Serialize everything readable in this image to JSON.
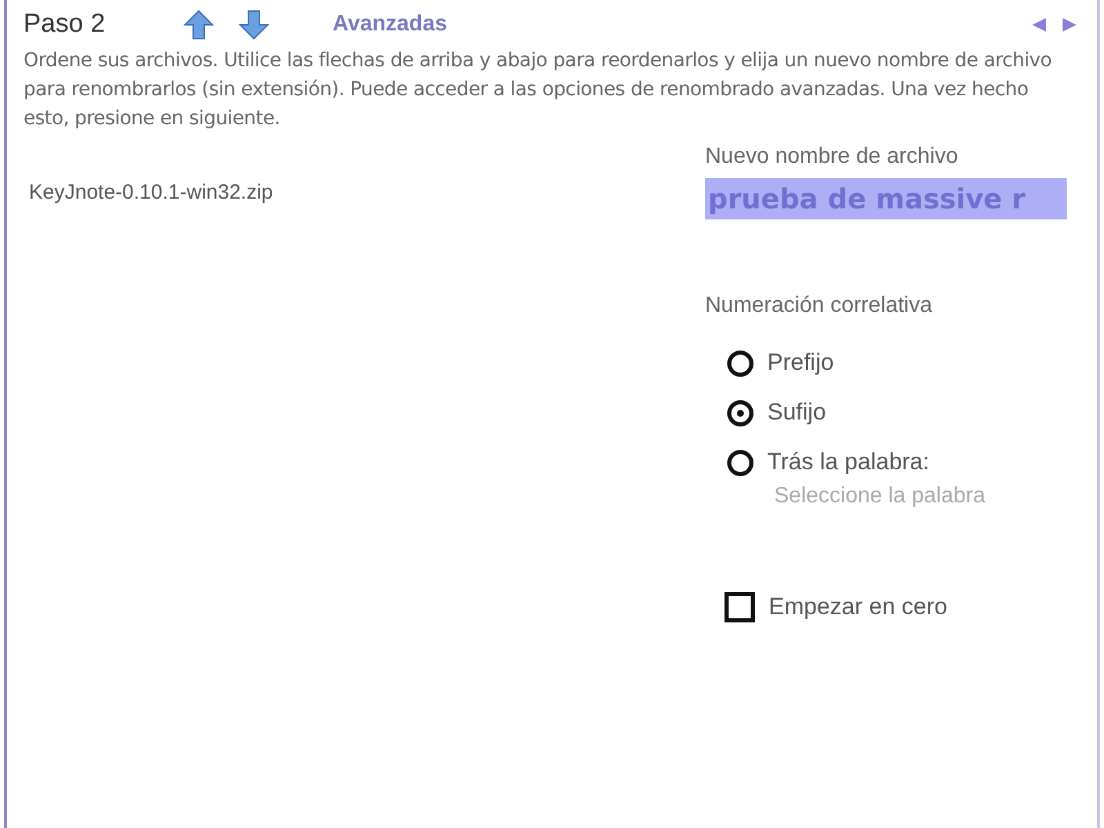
{
  "header": {
    "title": "Paso 2",
    "advanced_link": "Avanzadas"
  },
  "instructions": "Ordene sus archivos. Utilice las flechas de arriba y abajo para reordenarlos y elija un nuevo nombre de archivo para renombrarlos (sin extensión). Puede acceder a las opciones de renombrado avanzadas. Una vez hecho esto, presione en siguiente.",
  "files": [
    {
      "name": "KeyJnote-0.10.1-win32.zip",
      "selected": false
    }
  ],
  "new_name": {
    "label": "Nuevo nombre de archivo",
    "value": "prueba de massive r"
  },
  "numbering": {
    "label": "Numeración correlativa",
    "options": [
      {
        "label": "Prefijo",
        "selected": false
      },
      {
        "label": "Sufijo",
        "selected": true
      },
      {
        "label": "Trás la palabra:",
        "selected": false
      }
    ],
    "word_hint": "Seleccione la palabra"
  },
  "start_zero": {
    "label": "Empezar en cero",
    "checked": false
  }
}
